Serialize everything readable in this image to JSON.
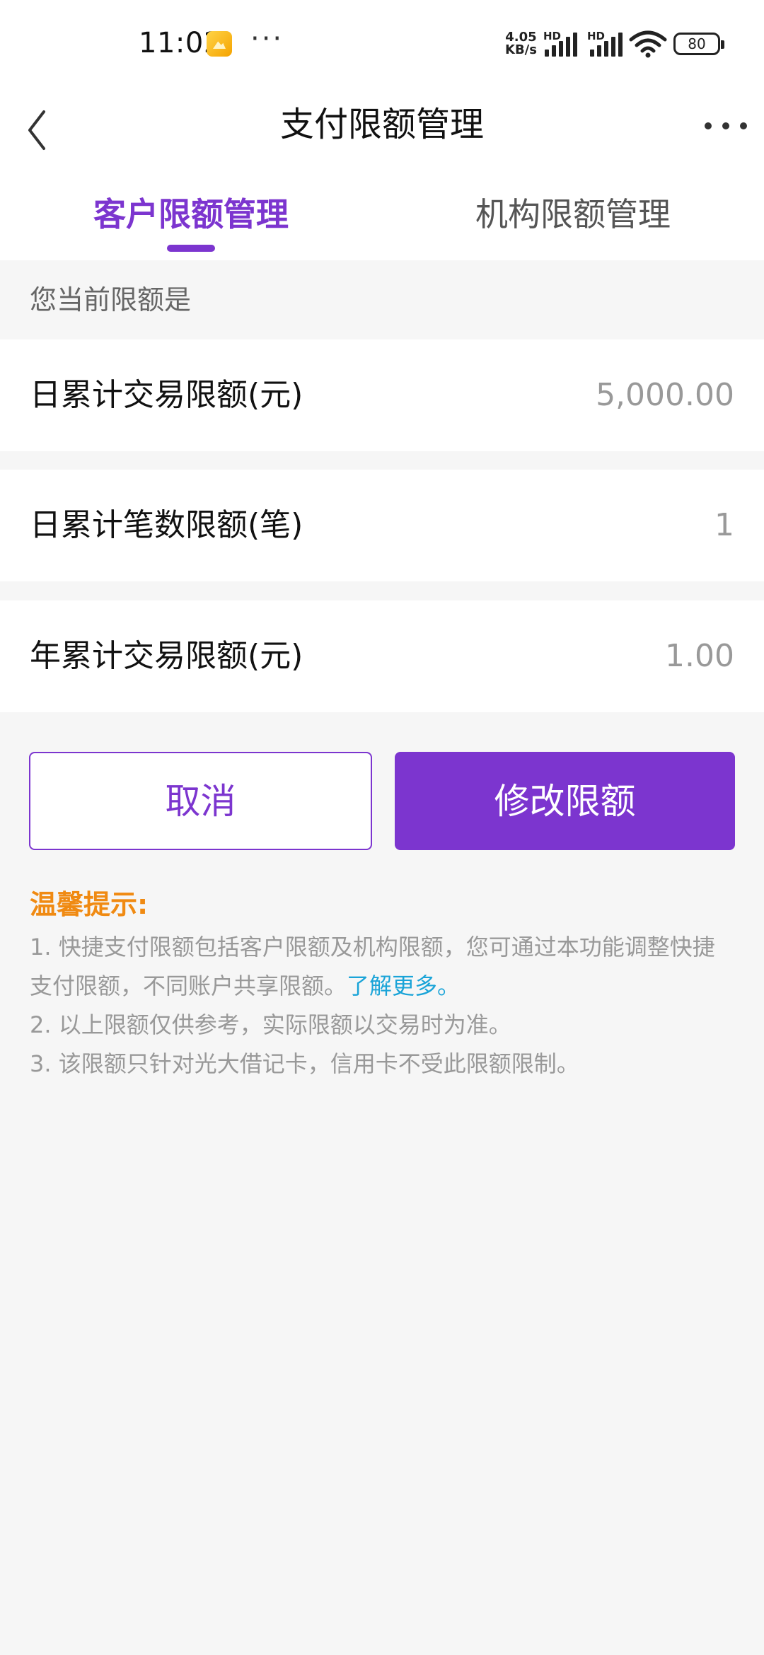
{
  "status_bar": {
    "time": "11:02",
    "dots": "···",
    "speed_value": "4.05",
    "speed_unit": "KB/s",
    "hd_1": "HD",
    "hd_2": "HD",
    "battery": "80"
  },
  "nav": {
    "title": "支付限额管理",
    "back_icon": "chevron-left-icon",
    "more_icon": "more-horizontal-icon"
  },
  "tabs": [
    {
      "label": "客户限额管理",
      "active": true
    },
    {
      "label": "机构限额管理",
      "active": false
    }
  ],
  "section_header": "您当前限额是",
  "limits": [
    {
      "label": "日累计交易限额(元)",
      "value": "5,000.00"
    },
    {
      "label": "日累计笔数限额(笔)",
      "value": "1"
    },
    {
      "label": "年累计交易限额(元)",
      "value": "1.00"
    }
  ],
  "buttons": {
    "cancel": "取消",
    "modify": "修改限额"
  },
  "tips": {
    "title": "温馨提示:",
    "line1_a": "1. 快捷支付限额包括客户限额及机构限额，您可通过本功能调整快捷",
    "line1_b": "支付限额，不同账户共享限额。",
    "link": "了解更多。",
    "line2": "2. 以上限额仅供参考，实际限额以交易时为准。",
    "line3": "3. 该限额只针对光大借记卡，信用卡不受此限额限制。"
  },
  "colors": {
    "accent": "#7c35cf",
    "tip_title": "#f08a12",
    "link": "#1aa4d8",
    "value_grey": "#999999",
    "background": "#f6f6f6"
  }
}
